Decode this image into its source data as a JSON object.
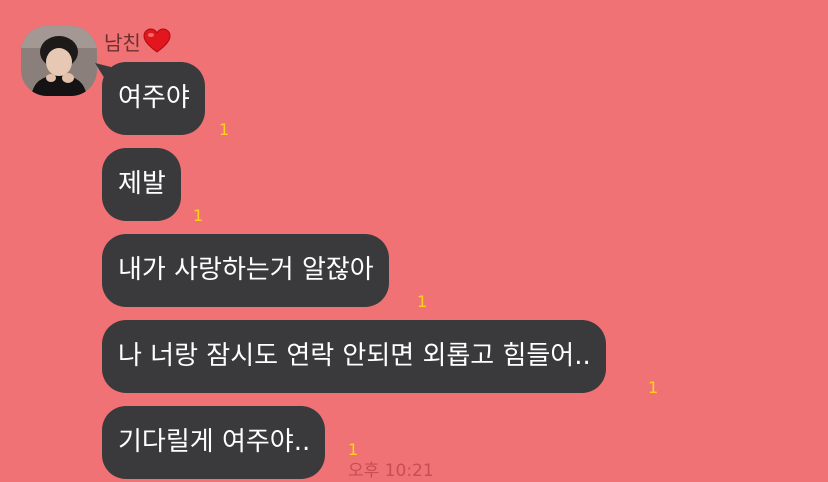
{
  "chat": {
    "background_color": "#f07274",
    "bubble_color": "#3a3a3c",
    "unread_color": "#ffd21e",
    "time_color": "#c84e52",
    "sender": {
      "name": "남친",
      "name_suffix_icon": "red-heart-icon",
      "avatar": "profile-photo"
    },
    "messages": [
      {
        "text": "여주야",
        "unread": "1"
      },
      {
        "text": "제발",
        "unread": "1"
      },
      {
        "text": "내가 사랑하는거 알잖아",
        "unread": "1"
      },
      {
        "text": "나 너랑 잠시도 연락 안되면 외롭고 힘들어..",
        "unread": "1"
      },
      {
        "text": "기다릴게 여주야..",
        "unread": "1"
      }
    ],
    "last_time": "오후 10:21"
  }
}
